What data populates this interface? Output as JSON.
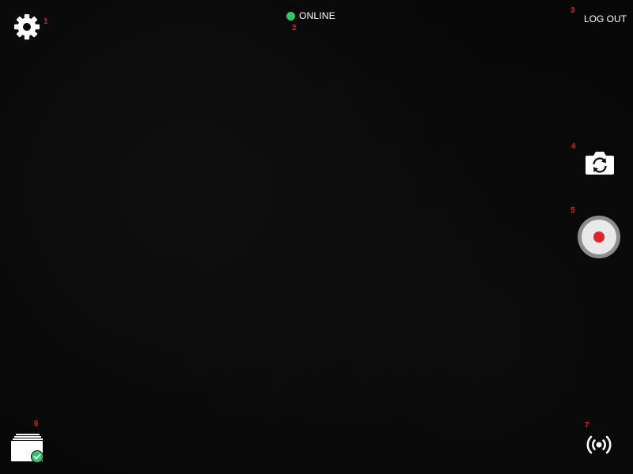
{
  "status": {
    "label": "ONLINE",
    "dot_color": "#2ec866"
  },
  "header": {
    "logout_label": "LOG OUT"
  },
  "controls": {
    "settings_icon": "gear-icon",
    "switch_camera_icon": "camera-switch-icon",
    "record_icon": "record-icon",
    "gallery_icon": "gallery-stack-icon",
    "broadcast_icon": "broadcast-icon",
    "record_dot_color": "#e0242a",
    "check_color": "#2ec866"
  },
  "annotations": [
    "1",
    "2",
    "3",
    "4",
    "5",
    "6",
    "7"
  ]
}
